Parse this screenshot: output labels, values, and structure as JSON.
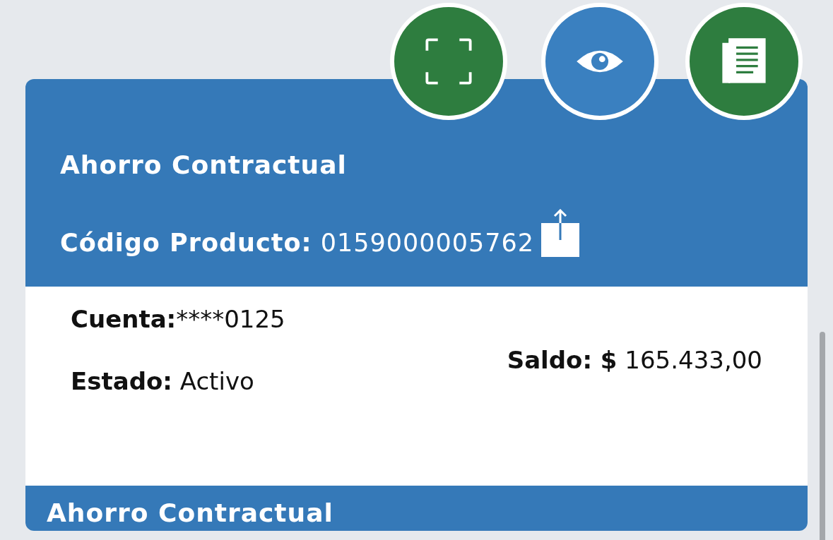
{
  "action_buttons": [
    {
      "kind": "scan",
      "color": "#2e7d3f"
    },
    {
      "kind": "view",
      "color": "#3a80c0"
    },
    {
      "kind": "document",
      "color": "#2e7d3f"
    }
  ],
  "product": {
    "title": "Ahorro Contractual",
    "code_label": "Código Producto:",
    "code_value": "0159000005762"
  },
  "details": {
    "account_label": "Cuenta:",
    "account_value": "****0125",
    "balance_label": "Saldo: $",
    "balance_value": "165.433,00",
    "status_label": "Estado:",
    "status_value": "Activo"
  },
  "next_product": {
    "title": "Ahorro Contractual"
  }
}
